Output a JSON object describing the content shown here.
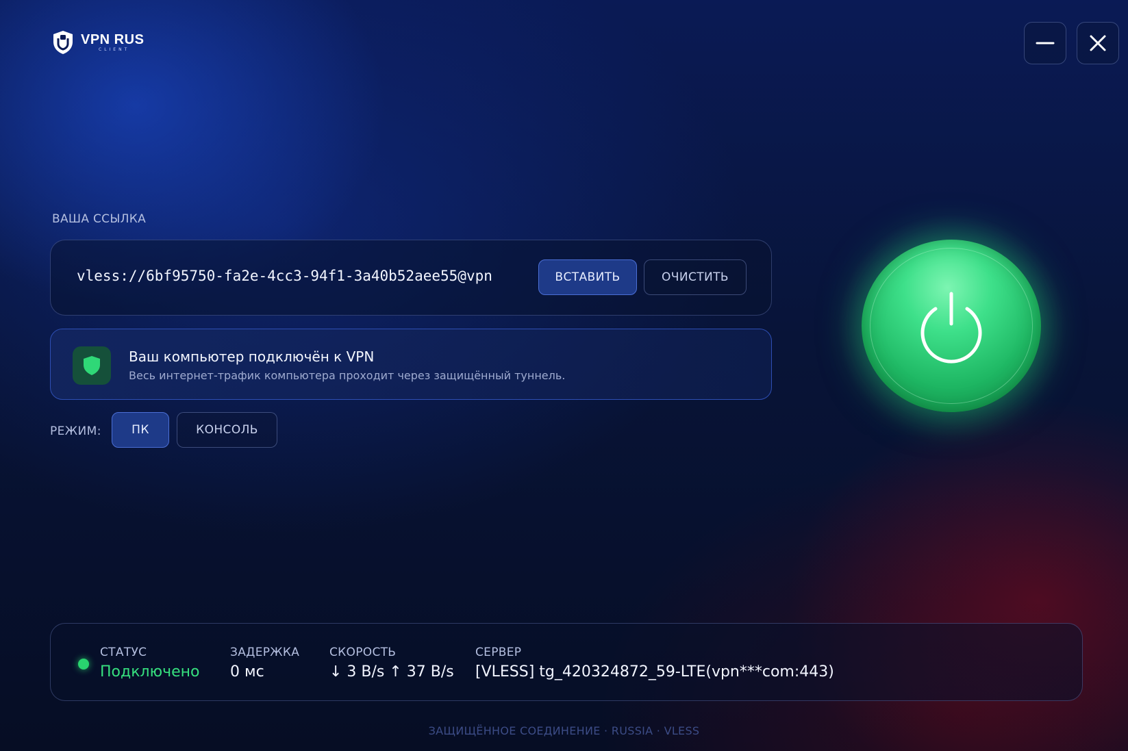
{
  "app": {
    "logo_name": "VPN RUS",
    "logo_sub": "CLIENT"
  },
  "window": {
    "minimize_icon": "minimize-icon",
    "close_icon": "close-icon"
  },
  "link": {
    "label": "ВАША ССЫЛКА",
    "value": "vless://6bf95750-fa2e-4cc3-94f1-3a40b52aee55@vpn",
    "paste_label": "ВСТАВИТЬ",
    "clear_label": "ОЧИСТИТЬ"
  },
  "notice": {
    "icon": "shield-icon",
    "title": "Ваш компьютер подключён к VPN",
    "description": "Весь интернет-трафик компьютера проходит через защищённый туннель."
  },
  "mode": {
    "label": "РЕЖИМ:",
    "options": [
      "ПК",
      "КОНСОЛЬ"
    ],
    "selected": "ПК"
  },
  "power": {
    "icon": "power-icon",
    "state": "on"
  },
  "status": {
    "status_label": "СТАТУС",
    "status_value": "Подключено",
    "latency_label": "ЗАДЕРЖКА",
    "latency_value": "0 мс",
    "speed_label": "СКОРОСТЬ",
    "speed_value": "↓ 3 B/s  ↑ 37 B/s",
    "server_label": "СЕРВЕР",
    "server_value": "[VLESS] tg_420324872_59-LTE(vpn***com:443)"
  },
  "footer": "ЗАЩИЩЁННОЕ СОЕДИНЕНИЕ · RUSSIA · VLESS",
  "colors": {
    "accent_green": "#36e07e",
    "button_active": "#1e3a88",
    "background_top": "#0a1a55"
  }
}
